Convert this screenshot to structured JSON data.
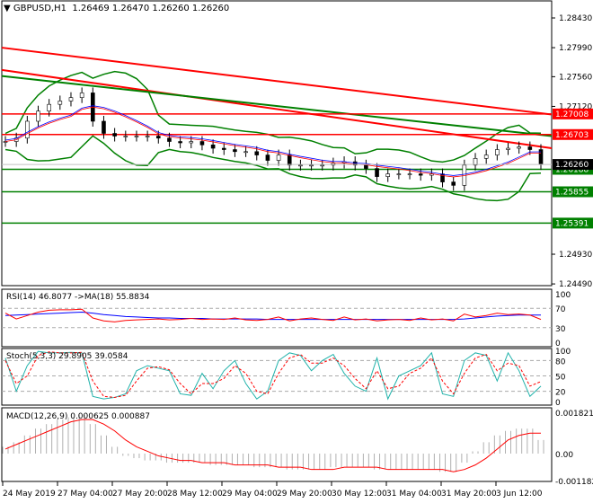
{
  "header": {
    "symbol": "GBPUSD,H1",
    "ohlc": "1.26469 1.26470 1.26260 1.26260"
  },
  "chart_data": [
    {
      "type": "candlestick",
      "title": "GBPUSD,H1",
      "ylim": [
        1.2428,
        1.2868
      ],
      "price_ticks": [
        "1.28430",
        "1.27990",
        "1.27560",
        "1.27120",
        "1.24930",
        "1.24490"
      ],
      "x_ticks": [
        "24 May 2019",
        "27 May 04:00",
        "27 May 20:00",
        "28 May 12:00",
        "29 May 04:00",
        "29 May 20:00",
        "30 May 12:00",
        "31 May 04:00",
        "31 May 20:00",
        "3 Jun 12:00"
      ],
      "close": [
        1.266,
        1.2665,
        1.269,
        1.2705,
        1.2715,
        1.272,
        1.2725,
        1.2732,
        1.269,
        1.2672,
        1.2668,
        1.2668,
        1.2668,
        1.2668,
        1.2665,
        1.266,
        1.2658,
        1.266,
        1.2655,
        1.265,
        1.2648,
        1.2645,
        1.2645,
        1.264,
        1.2632,
        1.264,
        1.2625,
        1.2625,
        1.2625,
        1.2625,
        1.2628,
        1.263,
        1.2625,
        1.262,
        1.2608,
        1.2612,
        1.2612,
        1.2612,
        1.261,
        1.2612,
        1.26,
        1.2595,
        1.2625,
        1.2635,
        1.264,
        1.2648,
        1.265,
        1.2652,
        1.2648,
        1.2626
      ],
      "levels": [
        {
          "value": "1.27008",
          "color": "#ff0000"
        },
        {
          "value": "1.26703",
          "color": "#ff0000"
        },
        {
          "value": "1.26188",
          "color": "#008000"
        },
        {
          "value": "1.25855",
          "color": "#008000"
        },
        {
          "value": "1.25391",
          "color": "#008000"
        }
      ],
      "current_price": "1.26260",
      "trendlines": [
        {
          "from": 1.2799,
          "to": 1.27,
          "color": "#ff0000"
        },
        {
          "from": 1.2766,
          "to": 1.265,
          "color": "#ff0000"
        },
        {
          "from": 1.2757,
          "to": 1.2668,
          "color": "#008000"
        }
      ]
    },
    {
      "type": "line",
      "label": "RSI(14) 46.8077  ->MA(18) 55.8834",
      "ylim": [
        0,
        100
      ],
      "ticks": [
        "100",
        "70",
        "30",
        "0"
      ],
      "rsi": [
        60,
        48,
        55,
        62,
        66,
        67,
        67,
        68,
        50,
        44,
        42,
        45,
        46,
        47,
        48,
        46,
        47,
        49,
        47,
        48,
        47,
        50,
        46,
        45,
        47,
        52,
        44,
        48,
        50,
        47,
        45,
        52,
        46,
        48,
        44,
        46,
        47,
        45,
        50,
        46,
        48,
        44,
        58,
        52,
        55,
        60,
        57,
        58,
        56,
        47
      ],
      "ma": [
        55,
        56,
        57,
        58,
        59,
        60,
        61,
        62,
        60,
        57,
        55,
        53,
        52,
        51,
        50,
        50,
        49,
        49,
        49,
        48,
        48,
        48,
        48,
        48,
        47,
        47,
        47,
        47,
        47,
        47,
        47,
        47,
        47,
        47,
        47,
        47,
        47,
        47,
        47,
        47,
        47,
        47,
        48,
        50,
        52,
        54,
        55,
        56,
        56,
        56
      ]
    },
    {
      "type": "line",
      "label": "Stoch(5,3,3) 29.8905 39.0584",
      "ylim": [
        0,
        100
      ],
      "ticks": [
        "100",
        "80",
        "50",
        "20",
        "0"
      ],
      "k": [
        85,
        20,
        70,
        98,
        95,
        95,
        96,
        95,
        10,
        5,
        8,
        15,
        60,
        70,
        65,
        60,
        15,
        12,
        55,
        25,
        60,
        80,
        35,
        5,
        20,
        80,
        95,
        90,
        60,
        80,
        92,
        55,
        30,
        20,
        85,
        5,
        50,
        60,
        70,
        95,
        15,
        10,
        80,
        95,
        90,
        40,
        95,
        60,
        10,
        30
      ],
      "d": [
        80,
        35,
        50,
        90,
        97,
        95,
        95,
        96,
        40,
        10,
        8,
        12,
        40,
        65,
        68,
        62,
        35,
        15,
        35,
        35,
        45,
        70,
        55,
        20,
        15,
        55,
        85,
        92,
        75,
        75,
        85,
        70,
        45,
        25,
        60,
        25,
        30,
        55,
        65,
        85,
        40,
        15,
        55,
        85,
        92,
        60,
        75,
        70,
        30,
        39
      ]
    },
    {
      "type": "histogram",
      "label": "MACD(12,26,9) 0.000625 0.000887",
      "ylim": [
        -0.001182,
        0.001821
      ],
      "ticks": [
        "0.001821",
        "0.00",
        "-0.001182"
      ],
      "hist": [
        0.0003,
        0.0005,
        0.0008,
        0.0011,
        0.0013,
        0.0015,
        0.0016,
        0.0017,
        0.0013,
        0.0008,
        0.0003,
        -0.0001,
        -0.0002,
        -0.0003,
        -0.0003,
        -0.0004,
        -0.0004,
        -0.0004,
        -0.0004,
        -0.0005,
        -0.0005,
        -0.0005,
        -0.0005,
        -0.0006,
        -0.0006,
        -0.0006,
        -0.0007,
        -0.0007,
        -0.0007,
        -0.0007,
        -0.0006,
        -0.0006,
        -0.0006,
        -0.0006,
        -0.0007,
        -0.0007,
        -0.0007,
        -0.0007,
        -0.0007,
        -0.0007,
        -0.0008,
        -0.0008,
        -0.0004,
        0.0001,
        0.0005,
        0.0008,
        0.001,
        0.0011,
        0.0011,
        0.0006
      ],
      "signal": [
        0.0002,
        0.0004,
        0.0006,
        0.0008,
        0.001,
        0.0012,
        0.0014,
        0.0015,
        0.0015,
        0.0013,
        0.001,
        0.0006,
        0.0003,
        0.0001,
        -0.0001,
        -0.0002,
        -0.0003,
        -0.0003,
        -0.0004,
        -0.0004,
        -0.0004,
        -0.0005,
        -0.0005,
        -0.0005,
        -0.0005,
        -0.0006,
        -0.0006,
        -0.0006,
        -0.0007,
        -0.0007,
        -0.0007,
        -0.0006,
        -0.0006,
        -0.0006,
        -0.0006,
        -0.0007,
        -0.0007,
        -0.0007,
        -0.0007,
        -0.0007,
        -0.0007,
        -0.0008,
        -0.0007,
        -0.0005,
        -0.0002,
        0.0002,
        0.0006,
        0.0008,
        0.0009,
        0.0009
      ]
    }
  ]
}
